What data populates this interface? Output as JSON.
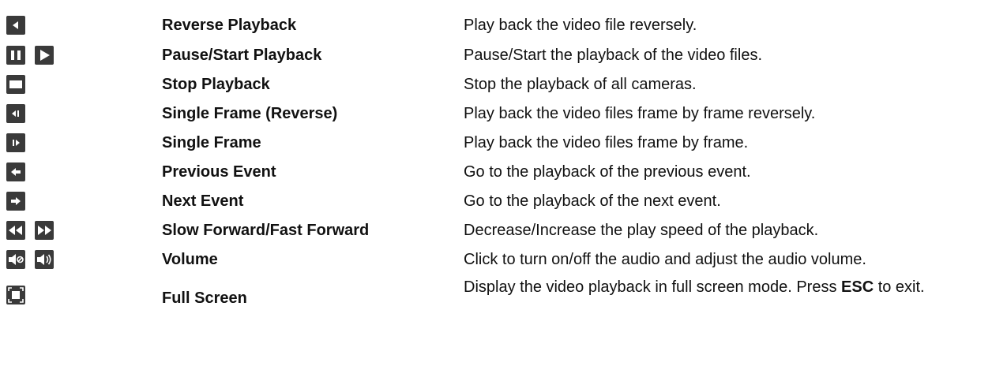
{
  "rows": [
    {
      "icons": [
        "reverse-play-icon"
      ],
      "name": "Reverse Playback",
      "desc": "Play back the video file reversely."
    },
    {
      "icons": [
        "pause-icon",
        "play-icon"
      ],
      "name": "Pause/Start Playback",
      "desc": "Pause/Start the playback of the video files."
    },
    {
      "icons": [
        "stop-icon"
      ],
      "name": "Stop Playback",
      "desc": "Stop the playback of all cameras."
    },
    {
      "icons": [
        "single-frame-reverse-icon"
      ],
      "name": "Single Frame (Reverse)",
      "desc": "Play back the video files frame by frame reversely."
    },
    {
      "icons": [
        "single-frame-icon"
      ],
      "name": "Single Frame",
      "desc": "Play back the video files frame by frame."
    },
    {
      "icons": [
        "previous-event-icon"
      ],
      "name": "Previous Event",
      "desc": "Go to the playback of the previous event."
    },
    {
      "icons": [
        "next-event-icon"
      ],
      "name": "Next Event",
      "desc": "Go to the playback of the next event."
    },
    {
      "icons": [
        "slow-forward-icon",
        "fast-forward-icon"
      ],
      "name": "Slow Forward/Fast Forward",
      "desc": "Decrease/Increase the play speed of the playback."
    },
    {
      "icons": [
        "volume-mute-icon",
        "volume-icon"
      ],
      "name": "Volume",
      "desc": "Click to turn on/off the audio and adjust the audio volume."
    },
    {
      "icons": [
        "full-screen-icon"
      ],
      "name": "Full Screen",
      "desc_before": "Display the video playback in full screen mode. Press ",
      "desc_bold": "ESC",
      "desc_after": " to exit."
    }
  ]
}
